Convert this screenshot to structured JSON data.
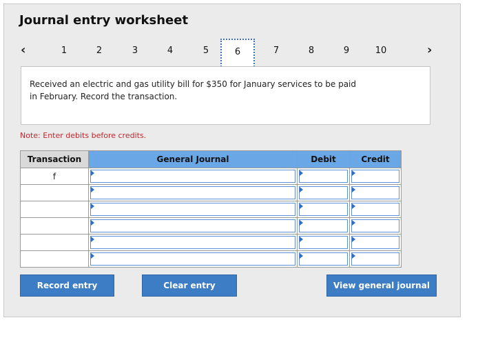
{
  "title": "Journal entry worksheet",
  "pagination": {
    "prev_icon": "‹",
    "next_icon": "›",
    "pages": [
      "1",
      "2",
      "3",
      "4",
      "5",
      "6",
      "7",
      "8",
      "9",
      "10"
    ],
    "active": "6"
  },
  "prompt": {
    "line1": "Received an electric and gas utility bill for $350 for January services to be paid",
    "line2": "in February. Record the transaction."
  },
  "note": "Note: Enter debits before credits.",
  "table": {
    "headers": {
      "transaction": "Transaction",
      "general_journal": "General Journal",
      "debit": "Debit",
      "credit": "Credit"
    },
    "rows": [
      {
        "transaction": "f",
        "account": "",
        "debit": "",
        "credit": ""
      },
      {
        "transaction": "",
        "account": "",
        "debit": "",
        "credit": ""
      },
      {
        "transaction": "",
        "account": "",
        "debit": "",
        "credit": ""
      },
      {
        "transaction": "",
        "account": "",
        "debit": "",
        "credit": ""
      },
      {
        "transaction": "",
        "account": "",
        "debit": "",
        "credit": ""
      },
      {
        "transaction": "",
        "account": "",
        "debit": "",
        "credit": ""
      }
    ]
  },
  "buttons": {
    "record": "Record entry",
    "clear": "Clear entry",
    "view": "View general journal"
  },
  "colors": {
    "header_blue": "#6aa7e7",
    "button_blue": "#3c7dc5",
    "note_red": "#c0272d"
  }
}
